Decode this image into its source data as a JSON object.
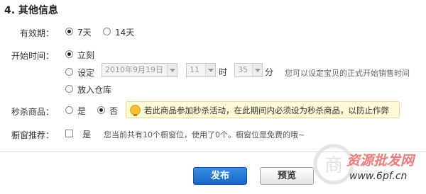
{
  "section": {
    "title": "4. 其他信息"
  },
  "validity": {
    "label": "有效期：",
    "options": [
      {
        "label": "7天",
        "checked": true
      },
      {
        "label": "14天",
        "checked": false
      }
    ]
  },
  "start_time": {
    "label": "开始时间：",
    "option_now": "立刻",
    "option_set": "设定",
    "date_value": "2010年9月19日",
    "hour_value": "11",
    "hour_unit": "时",
    "minute_value": "35",
    "minute_unit": "分",
    "hint": "您可以设定宝贝的正式开始销售时间",
    "option_warehouse": "放入仓库",
    "selected": "立刻"
  },
  "flash_sale": {
    "label": "秒杀商品：",
    "option_yes": "是",
    "option_no": "否",
    "selected": "否",
    "tip": "若此商品参加秒杀活动，在此期间内必须设为秒杀商品，以防止作弊"
  },
  "showcase": {
    "label": "橱窗推荐：",
    "option_yes": "是",
    "checked": false,
    "hint": "您当前共有10个橱窗位，使用了0个。橱窗位是免费的哦~"
  },
  "buttons": {
    "publish": "发布",
    "preview": "预览"
  },
  "watermark": {
    "line1": "资源批发网",
    "line2": "www.6pf.cn",
    "logo_text": "商"
  },
  "colors": {
    "publish_button": "#1f6fd0",
    "tip_background": "#fffbd9",
    "tip_icon": "#f6c233",
    "watermark": "#f07b7b"
  }
}
